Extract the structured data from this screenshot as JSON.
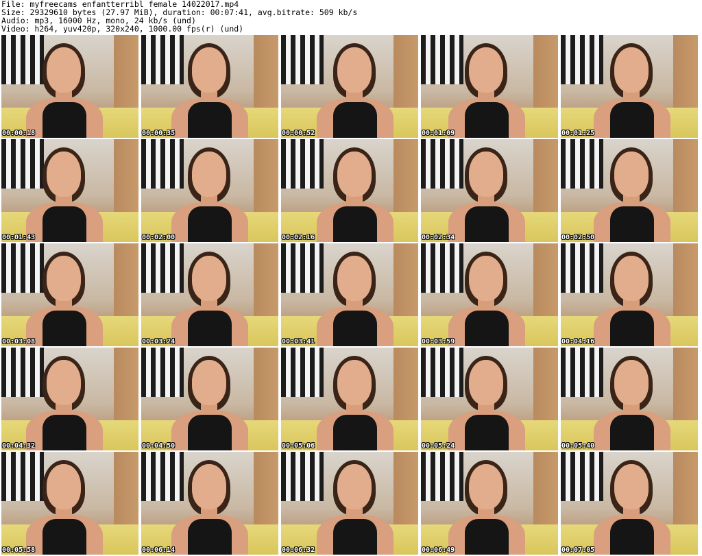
{
  "header": {
    "file": "File: myfreecams_enfantterribl_female_14022017.mp4",
    "size": "Size: 29329610 bytes (27.97 MiB), duration: 00:07:41, avg.bitrate: 509 kb/s",
    "audio": "Audio: mp3, 16000 Hz, mono, 24 kb/s (und)",
    "video": "Video: h264, yuv420p, 320x240, 1000.00 fps(r) (und)"
  },
  "thumbnails": [
    {
      "timestamp": "00:00:18"
    },
    {
      "timestamp": "00:00:35"
    },
    {
      "timestamp": "00:00:52"
    },
    {
      "timestamp": "00:01:09"
    },
    {
      "timestamp": "00:01:25"
    },
    {
      "timestamp": "00:01:43"
    },
    {
      "timestamp": "00:02:00"
    },
    {
      "timestamp": "00:02:16"
    },
    {
      "timestamp": "00:02:34"
    },
    {
      "timestamp": "00:02:50"
    },
    {
      "timestamp": "00:03:08"
    },
    {
      "timestamp": "00:03:24"
    },
    {
      "timestamp": "00:03:41"
    },
    {
      "timestamp": "00:03:59"
    },
    {
      "timestamp": "00:04:16"
    },
    {
      "timestamp": "00:04:32"
    },
    {
      "timestamp": "00:04:50"
    },
    {
      "timestamp": "00:05:06"
    },
    {
      "timestamp": "00:05:24"
    },
    {
      "timestamp": "00:05:40"
    },
    {
      "timestamp": "00:05:58"
    },
    {
      "timestamp": "00:06:14"
    },
    {
      "timestamp": "00:06:32"
    },
    {
      "timestamp": "00:06:49"
    },
    {
      "timestamp": "00:07:05"
    }
  ]
}
